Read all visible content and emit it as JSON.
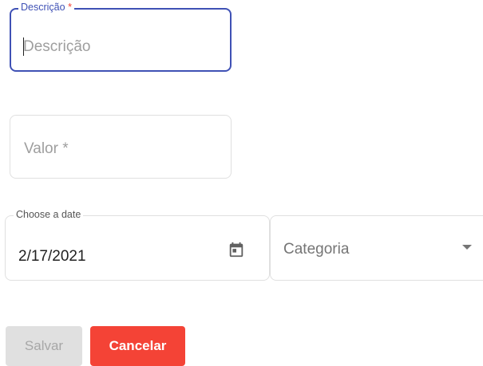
{
  "form": {
    "descricao": {
      "label": "Descrição",
      "required_mark": "*",
      "placeholder": "Descrição"
    },
    "valor": {
      "placeholder": "Valor *"
    },
    "date": {
      "label": "Choose a date",
      "value": "2/17/2021",
      "icon": "calendar-icon"
    },
    "categoria": {
      "placeholder": "Categoria",
      "icon": "dropdown-arrow-icon"
    }
  },
  "actions": {
    "save_label": "Salvar",
    "cancel_label": "Cancelar"
  },
  "colors": {
    "focus": "#3f51b5",
    "required": "#f44336",
    "danger": "#f44336",
    "disabled_bg": "#e0e0e0",
    "disabled_text": "#a7a7a7"
  }
}
